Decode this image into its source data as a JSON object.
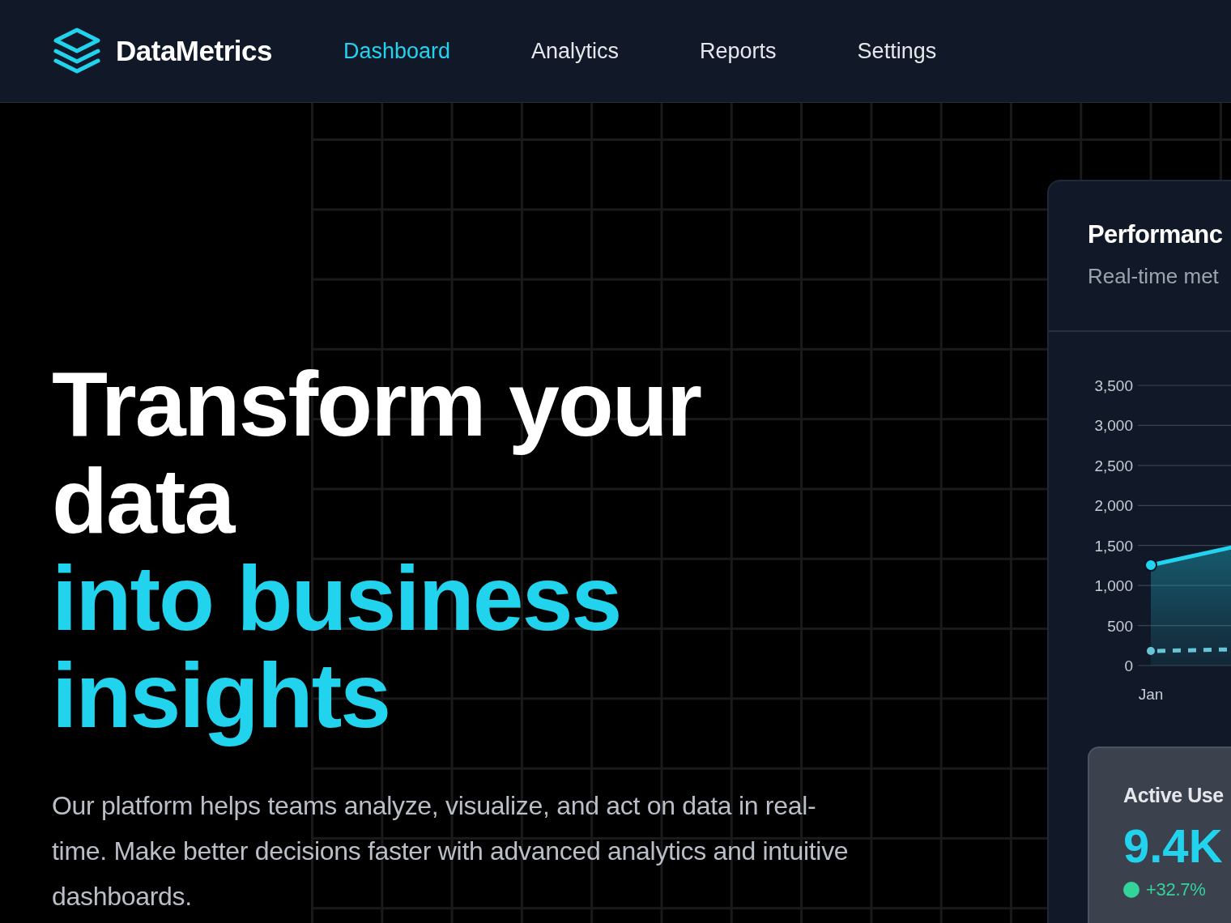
{
  "brand": {
    "name": "DataMetrics"
  },
  "nav": [
    {
      "label": "Dashboard",
      "selected": true
    },
    {
      "label": "Analytics",
      "selected": false
    },
    {
      "label": "Reports",
      "selected": false
    },
    {
      "label": "Settings",
      "selected": false
    }
  ],
  "hero": {
    "heading_lines": [
      {
        "text": "Transform your data",
        "kind": "plain"
      },
      {
        "text": "into business insights",
        "kind": "accent"
      }
    ],
    "description": "Our platform helps teams analyze, visualize, and act on data in real-time. Make better decisions faster with advanced analytics and intuitive dashboards."
  },
  "card": {
    "title": "Performanc",
    "subtitle": "Real-time met",
    "chart": {
      "y_axis_labels": [
        "3,500",
        "3,000",
        "2,500",
        "2,000",
        "1,500",
        "1,000",
        "500",
        "0"
      ],
      "x_axis_labels": [
        "Jan"
      ]
    },
    "stat": {
      "label": "Active Use",
      "value": "9.4K",
      "change": "+32.7%"
    }
  }
}
